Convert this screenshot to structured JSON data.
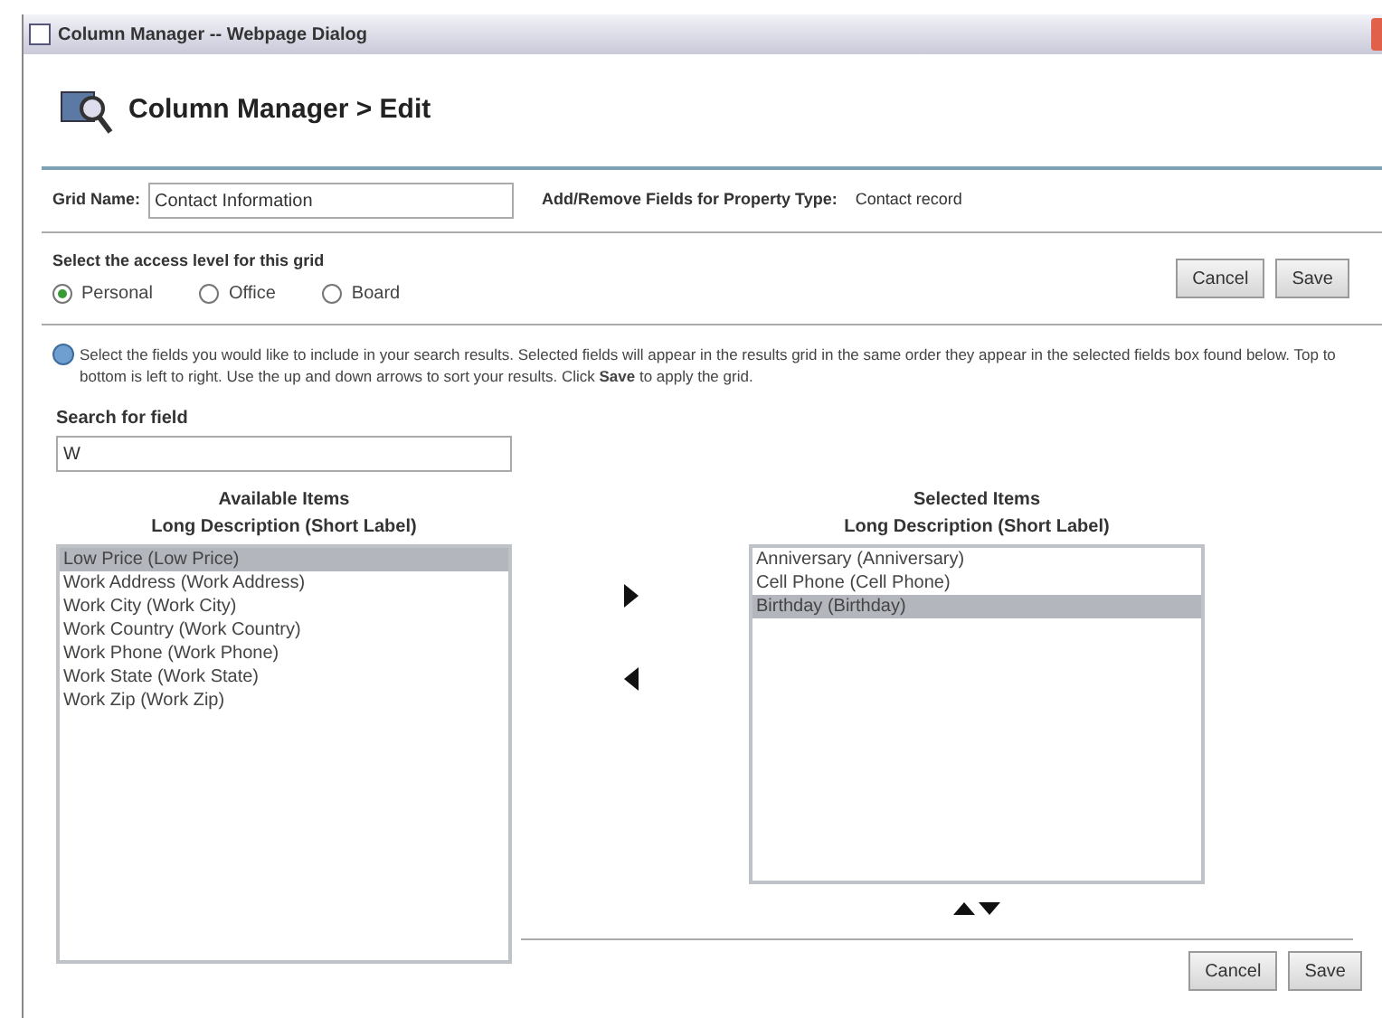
{
  "window": {
    "title": "Column Manager -- Webpage Dialog"
  },
  "header": {
    "title": "Column Manager > Edit"
  },
  "grid_name": {
    "label": "Grid Name:",
    "value": "Contact Information"
  },
  "property_type": {
    "label": "Add/Remove Fields for Property Type:",
    "value": "Contact record"
  },
  "access_level": {
    "label": "Select the access level for this grid",
    "options": [
      {
        "label": "Personal",
        "selected": true
      },
      {
        "label": "Office",
        "selected": false
      },
      {
        "label": "Board",
        "selected": false
      }
    ]
  },
  "top_buttons": [
    "Cancel",
    "Save"
  ],
  "info": "Select the fields you would like to include in your search results. Selected fields will appear in the results grid in the same order they appear in the selected fields box found below. Top to bottom is left to right. Use the up and down arrows to sort your results. Click **Save** to apply the grid.",
  "search": {
    "label": "Search for field",
    "value": "W"
  },
  "available": {
    "title": "Available Items",
    "subtitle": "Long Description (Short Label)",
    "items": [
      {
        "label": "Low Price (Low Price)",
        "selected": true
      },
      {
        "label": "Work Address (Work Address)",
        "selected": false
      },
      {
        "label": "Work City (Work City)",
        "selected": false
      },
      {
        "label": "Work Country (Work Country)",
        "selected": false
      },
      {
        "label": "Work Phone (Work Phone)",
        "selected": false
      },
      {
        "label": "Work State (Work State)",
        "selected": false
      },
      {
        "label": "Work Zip (Work Zip)",
        "selected": false
      }
    ]
  },
  "selected_list": {
    "title": "Selected Items",
    "subtitle": "Long Description (Short Label)",
    "items": [
      {
        "label": "Anniversary (Anniversary)",
        "selected": false
      },
      {
        "label": "Cell Phone (Cell Phone)",
        "selected": false
      },
      {
        "label": "Birthday (Birthday)",
        "selected": true
      }
    ]
  },
  "bottom_buttons": [
    "Cancel",
    "Save"
  ]
}
